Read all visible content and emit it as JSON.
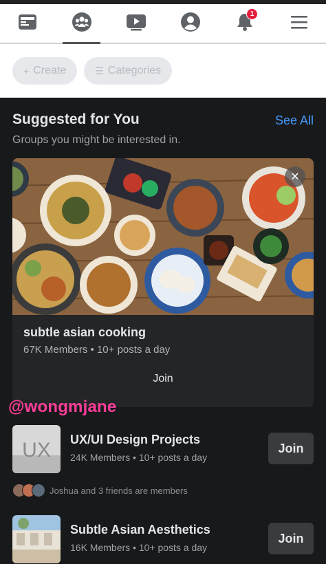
{
  "nav": {
    "notifications_badge": "1",
    "active": "groups",
    "icons": [
      "feed-icon",
      "groups-icon",
      "watch-icon",
      "profile-icon",
      "bell-icon",
      "menu-icon"
    ]
  },
  "filters": {
    "chips": [
      {
        "label": "Create"
      },
      {
        "label": "Categories"
      }
    ]
  },
  "suggested": {
    "title": "Suggested for You",
    "see_all": "See All",
    "subtitle": "Groups you might be interested in."
  },
  "featured": {
    "name": "subtle asian cooking",
    "meta": "67K Members • 10+ posts a day",
    "join_label": "Join",
    "close_glyph": "×"
  },
  "watermark": "@wongmjane",
  "groups": [
    {
      "name": "UX/UI Design Projects",
      "meta": "24K Members • 10+ posts a day",
      "join_label": "Join",
      "thumb_text": "UX",
      "friends_text": "Joshua and 3 friends are members"
    },
    {
      "name": "Subtle Asian Aesthetics",
      "meta": "16K Members • 10+ posts a day",
      "join_label": "Join"
    }
  ],
  "colors": {
    "accent": "#4599ff",
    "badge": "#e41e3f",
    "background": "#18191a",
    "card": "#242526",
    "watermark": "#ff3d9a"
  }
}
